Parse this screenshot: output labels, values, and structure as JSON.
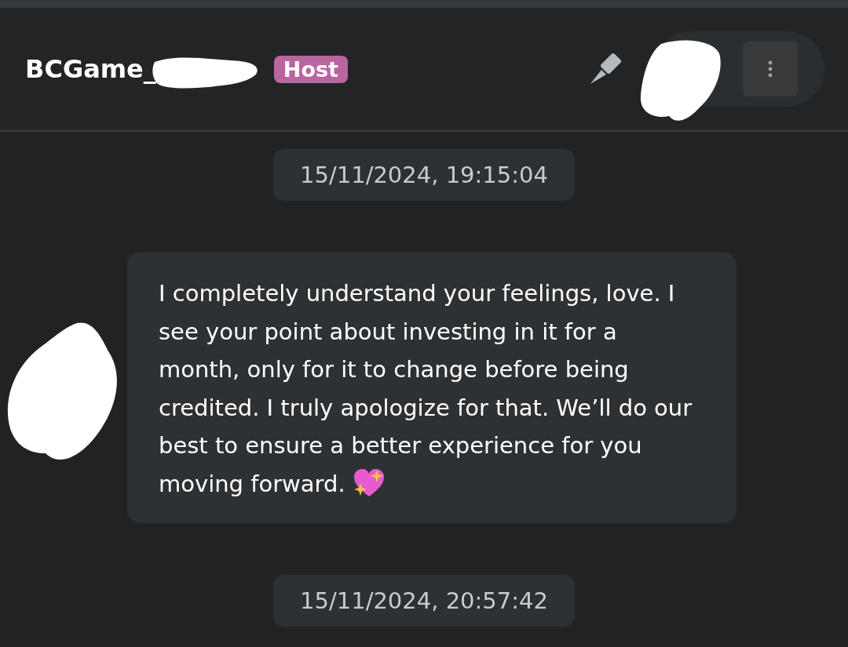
{
  "header": {
    "name": "BCGame_",
    "badge": "Host"
  },
  "messages": [
    {
      "kind": "timestamp",
      "text": "15/11/2024, 19:15:04"
    },
    {
      "kind": "message",
      "text": "I completely understand your feelings, love. I see your point about investing in it for a month, only for it to change before being credited. I truly apologize for that. We’ll do our best to ensure a better experience for you moving forward."
    },
    {
      "kind": "timestamp",
      "text": "15/11/2024, 20:57:42"
    }
  ]
}
